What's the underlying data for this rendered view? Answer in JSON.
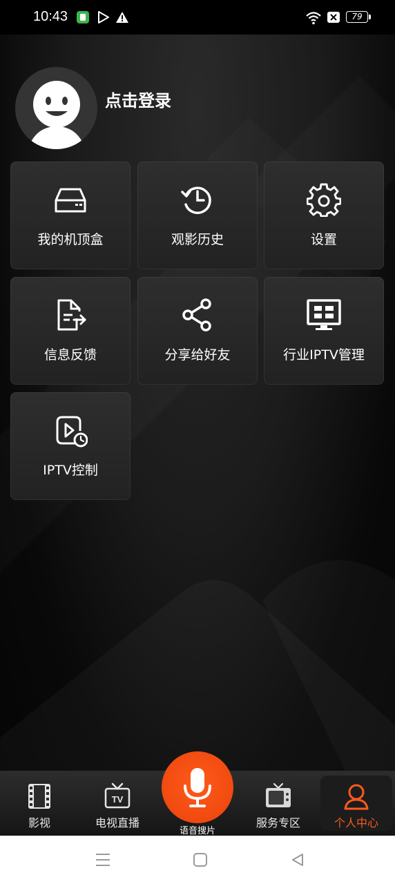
{
  "status_bar": {
    "time": "10:43",
    "battery": "79"
  },
  "profile": {
    "login_text": "点击登录"
  },
  "tiles": [
    {
      "label": "我的机顶盒",
      "icon": "set-top-box-icon"
    },
    {
      "label": "观影历史",
      "icon": "history-icon"
    },
    {
      "label": "设置",
      "icon": "settings-gear-icon"
    },
    {
      "label": "信息反馈",
      "icon": "feedback-document-icon"
    },
    {
      "label": "分享给好友",
      "icon": "share-icon"
    },
    {
      "label": "行业IPTV管理",
      "icon": "monitor-grid-icon"
    },
    {
      "label": "IPTV控制",
      "icon": "play-clock-icon"
    }
  ],
  "tabbar": {
    "items": [
      {
        "label": "影视",
        "icon": "film-icon"
      },
      {
        "label": "电视直播",
        "icon": "tv-live-icon"
      },
      {
        "label": "语音搜片",
        "icon": "microphone-icon"
      },
      {
        "label": "服务专区",
        "icon": "retro-tv-icon"
      },
      {
        "label": "个人中心",
        "icon": "person-icon"
      }
    ],
    "active_index": 4
  },
  "colors": {
    "accent": "#F04A10",
    "active_tab_text": "#FF5A1E",
    "background": "#000000"
  }
}
